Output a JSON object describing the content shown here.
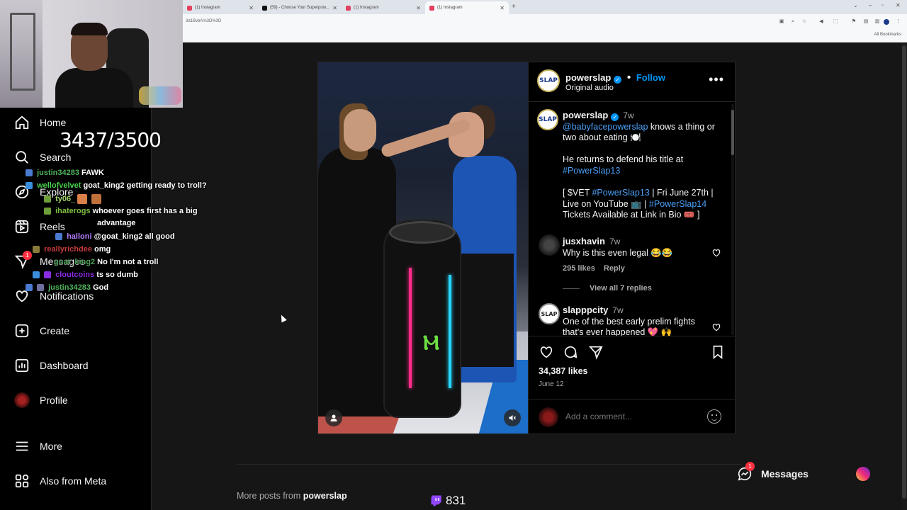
{
  "browser": {
    "tabs": [
      {
        "title": "(1) Instagram",
        "fav": "#e4405f"
      },
      {
        "title": "(59) - Choose Your Superpow...",
        "fav": "#111111"
      },
      {
        "title": "(1) Instagram",
        "fav": "#e4405f"
      },
      {
        "title": "(1) Instagram",
        "fav": "#e4405f",
        "active": true
      }
    ],
    "new_tab": "+",
    "url": "3d1BvbA%3D%3D",
    "all_bookmarks": "All Bookmarks"
  },
  "sidebar": {
    "items": [
      {
        "label": "Home",
        "icon": "home-icon"
      },
      {
        "label": "Search",
        "icon": "search-icon"
      },
      {
        "label": "Explore",
        "icon": "compass-icon"
      },
      {
        "label": "Reels",
        "icon": "reels-icon"
      },
      {
        "label": "Messages",
        "icon": "messenger-icon",
        "badge": "1"
      },
      {
        "label": "Notifications",
        "icon": "heart-icon"
      },
      {
        "label": "Create",
        "icon": "plus-square-icon"
      },
      {
        "label": "Dashboard",
        "icon": "dashboard-icon"
      },
      {
        "label": "Profile",
        "icon": "profile-avatar"
      },
      {
        "label": "More",
        "icon": "menu-icon"
      },
      {
        "label": "Also from Meta",
        "icon": "meta-icon"
      }
    ]
  },
  "overlay": {
    "counter": "3437/3500",
    "chat": [
      {
        "user": "justin34283",
        "color": "#4fb35a",
        "msg": "FAWK"
      },
      {
        "user": "wellofvelvet",
        "color": "#47d14d",
        "msg": "goat_king2 getting ready to troll?"
      },
      {
        "user": "ty06_",
        "color": "#a0d468",
        "msg": ""
      },
      {
        "user": "ihaterogs",
        "color": "#7fbf3f",
        "msg": "whoever goes first has a big"
      },
      {
        "user": "",
        "color": "#ffffff",
        "msg": "advantage"
      },
      {
        "user": "halloni",
        "color": "#b57bff",
        "msg": "@goat_king2 all good"
      },
      {
        "user": "reallyrichdee",
        "color": "#c33b3b",
        "msg": "omg"
      },
      {
        "user": "goat_king2",
        "color": "#4fa35a",
        "msg": "No I'm not a troll"
      },
      {
        "user": "cloutcoins",
        "color": "#8a2be2",
        "msg": "ts so dumb"
      },
      {
        "user": "justin34283",
        "color": "#4fb35a",
        "msg": "God"
      }
    ],
    "twitch_viewers": "831"
  },
  "post": {
    "header": {
      "username": "powerslap",
      "follow": "Follow",
      "audio": "Original audio",
      "avatar_text": "SLAP"
    },
    "caption": {
      "username": "powerslap",
      "time": "7w",
      "mention": "@babyfacepowerslap",
      "line1_rest": " knows a thing or",
      "line2": "two about eating 🍽️",
      "line3": "He returns to defend his title at",
      "tag1": "#PowerSlap13",
      "line4a": "[ $VET ",
      "tag2": "#PowerSlap13",
      "line4b": " | Fri June 27th |",
      "line5a": "Live on YouTube 📺 | ",
      "tag3": "#PowerSlap14",
      "line6": "Tickets Available at Link in Bio 🎟️ ]"
    },
    "comments": [
      {
        "username": "jusxhavin",
        "time": "7w",
        "text": "Why is this even legal 😂😂",
        "likes": "295 likes",
        "reply": "Reply",
        "view_replies": "View all 7 replies"
      },
      {
        "username": "slapppcity",
        "time": "7w",
        "text": "One of the best early prelim fights",
        "text2": "that's ever happened 💖 🙌"
      }
    ],
    "likes": "34,387 likes",
    "date": "June 12",
    "add_comment_placeholder": "Add a comment..."
  },
  "footer": {
    "more_posts_prefix": "More posts from ",
    "more_posts_user": "powerslap",
    "messages_label": "Messages",
    "messages_badge": "1"
  },
  "colors": {
    "accent_blue": "#0095f6",
    "badge_red": "#ff3040",
    "background": "#000000"
  }
}
